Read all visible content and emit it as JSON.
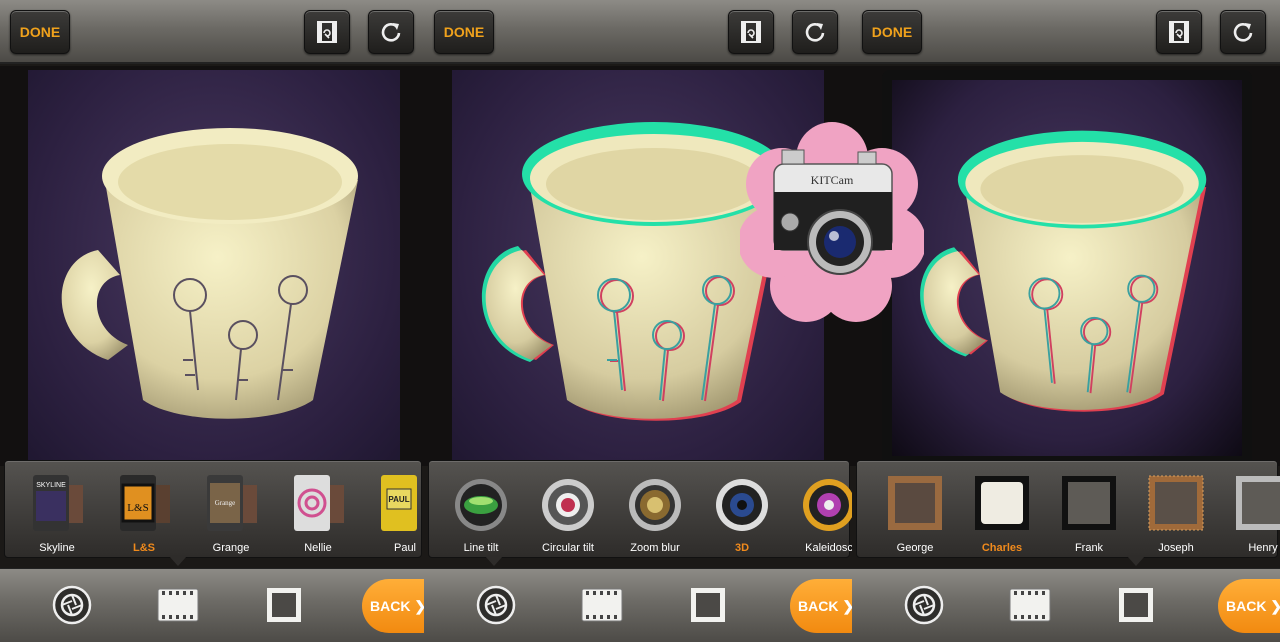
{
  "panels": [
    {
      "done_label": "DONE",
      "back_label": "BACK ❯",
      "strip": {
        "items": [
          {
            "label": "Skyline",
            "selected": false
          },
          {
            "label": "L&S",
            "selected": true
          },
          {
            "label": "Grange",
            "selected": false
          },
          {
            "label": "Nellie",
            "selected": false
          },
          {
            "label": "Paul",
            "selected": false
          }
        ]
      },
      "active_tab": "film"
    },
    {
      "done_label": "DONE",
      "back_label": "BACK ❯",
      "strip": {
        "items": [
          {
            "label": "Line tilt",
            "selected": false
          },
          {
            "label": "Circular tilt",
            "selected": false
          },
          {
            "label": "Zoom blur",
            "selected": false
          },
          {
            "label": "3D",
            "selected": true
          },
          {
            "label": "Kaleidosc",
            "selected": false
          }
        ]
      },
      "active_tab": "effects"
    },
    {
      "done_label": "DONE",
      "back_label": "BACK ❯",
      "strip": {
        "items": [
          {
            "label": "George",
            "selected": false
          },
          {
            "label": "Charles",
            "selected": true
          },
          {
            "label": "Frank",
            "selected": false
          },
          {
            "label": "Joseph",
            "selected": false
          },
          {
            "label": "Henry",
            "selected": false
          }
        ]
      },
      "active_tab": "frames"
    }
  ],
  "film_thumb_labels": [
    "SKYLINE",
    "L&S",
    "Grange",
    "",
    "PAUL"
  ],
  "logo": {
    "text": "KITCam"
  },
  "colors": {
    "accent": "#f08a1c",
    "selected_label": "#f08a1c",
    "back_button": "#f5931a",
    "logo_petal": "#f0a3c3"
  }
}
